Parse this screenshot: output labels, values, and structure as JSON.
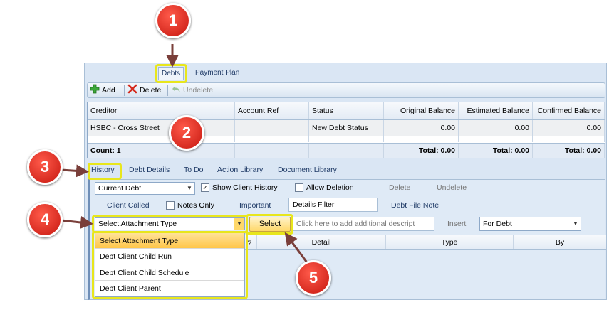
{
  "top_tabs": [
    "Debts",
    "Payment Plan"
  ],
  "toolbar": {
    "add": "Add",
    "delete": "Delete",
    "undelete": "Undelete"
  },
  "debts_grid": {
    "columns": [
      "Creditor",
      "Account Ref",
      "Status",
      "Original Balance",
      "Estimated Balance",
      "Confirmed Balance"
    ],
    "rows": [
      [
        "HSBC - Cross Street",
        "",
        "New Debt Status",
        "0.00",
        "0.00",
        "0.00"
      ]
    ],
    "footer": {
      "count": "Count: 1",
      "total1": "Total: 0.00",
      "total2": "Total: 0.00",
      "total3": "Total: 0.00"
    }
  },
  "history_tabs": [
    "History",
    "Debt Details",
    "To Do",
    "Action Library",
    "Document Library"
  ],
  "history": {
    "debt_combo": "Current Debt",
    "show_client_history": "Show Client History",
    "allow_deletion": "Allow Deletion",
    "delete": "Delete",
    "undelete": "Undelete",
    "client_called": "Client Called",
    "notes_only": "Notes Only",
    "important": "Important",
    "details_filter": "Details Filter",
    "debt_file_note": "Debt File Note",
    "attachment_combo": "Select Attachment Type",
    "select_button": "Select",
    "description_placeholder": "Click here to add additional descript",
    "insert": "Insert",
    "for_combo": "For Debt"
  },
  "attachment_grid_columns": [
    "Detail",
    "Type",
    "By"
  ],
  "attachment_options": [
    "Select Attachment Type",
    "Debt Client Child Run",
    "Debt Client Child Schedule",
    "Debt Client Parent"
  ],
  "markers": [
    "1",
    "2",
    "3",
    "4",
    "5"
  ],
  "colors": {
    "marker_red": "#d11f14",
    "highlight_yellow": "#e8e61c",
    "selected_item": "#ffc648"
  }
}
